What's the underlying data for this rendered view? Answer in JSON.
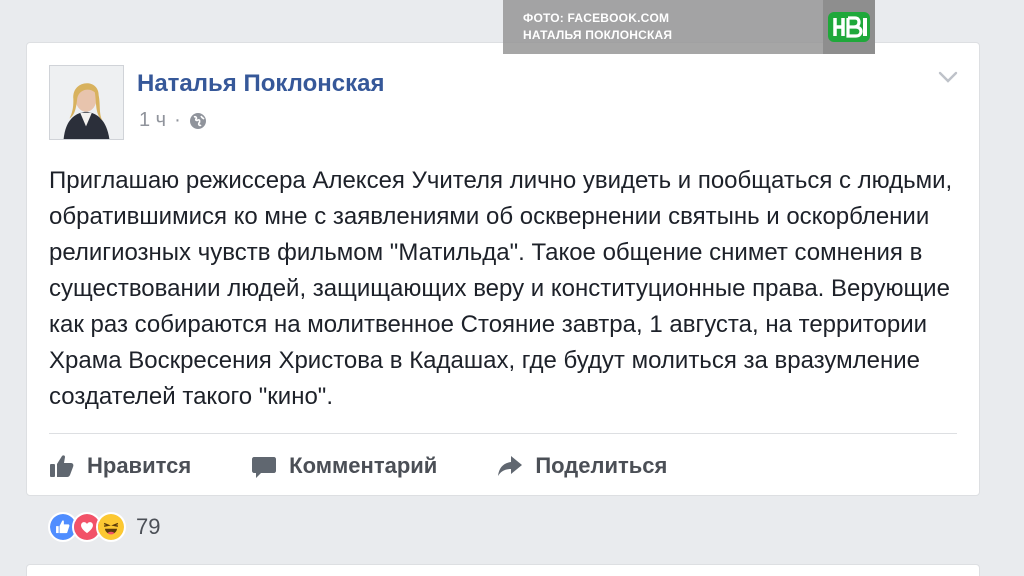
{
  "overlay": {
    "photo_credit_line1": "ФОТО: FACEBOOK.COM",
    "photo_credit_line2": "НАТАЛЬЯ ПОКЛОНСКАЯ",
    "logo_icon": "ntv-logo-icon",
    "logo_color": "#1fa83a"
  },
  "post": {
    "author": "Наталья Поклонская",
    "time": "1 ч",
    "separator": "·",
    "privacy_icon": "globe-icon",
    "menu_icon": "chevron-down-icon",
    "text": "Приглашаю режиссера Алексея Учителя лично увидеть и пообщаться с людьми, обратившимися ко мне с заявлениями об осквернении святынь и оскорблении религиозных чувств фильмом \"Матильда\". Такое общение снимет сомнения в существовании людей, защищающих веру и конституционные права. Верующие как раз собираются на молитвенное Стояние завтра, 1 августа, на территории Храма Воскресения Христова в Кадашах, где будут молиться за вразумление создателей такого \"кино\"."
  },
  "actions": {
    "like_label": "Нравится",
    "comment_label": "Комментарий",
    "share_label": "Поделиться",
    "like_icon": "thumbs-up-icon",
    "comment_icon": "speech-bubble-icon",
    "share_icon": "share-arrow-icon"
  },
  "reactions": {
    "icons": [
      "like-reaction-icon",
      "love-reaction-icon",
      "haha-reaction-icon"
    ],
    "count": "79",
    "colors": {
      "like": "#4f8dff",
      "love": "#f25268",
      "haha": "#fcc832"
    }
  },
  "colors": {
    "author_link": "#365899",
    "body_text": "#1d2129",
    "muted": "#90949c",
    "page_bg": "#e9ebee"
  }
}
